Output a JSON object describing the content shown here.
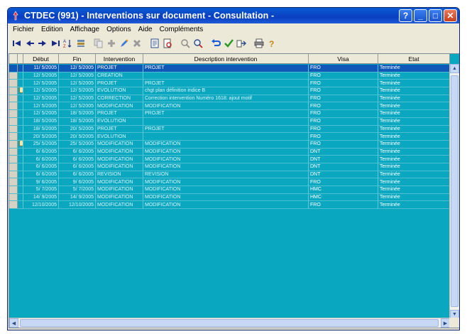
{
  "window": {
    "title": "CTDEC (991) - Interventions sur document - Consultation -",
    "buttons": {
      "help": "?",
      "minimize": "_",
      "maximize": "□",
      "close": "✕"
    }
  },
  "menu": [
    "Fichier",
    "Edition",
    "Affichage",
    "Options",
    "Aide",
    "Compléments"
  ],
  "toolbar": [
    "first-record-icon",
    "prev-record-icon",
    "next-record-icon",
    "last-record-icon",
    "sort-icon",
    "filter-icon",
    "copy-icon",
    "add-icon",
    "edit-icon",
    "delete-icon",
    "document-icon",
    "print-preview-icon",
    "search-icon",
    "find-next-icon",
    "undo-icon",
    "validate-icon",
    "export-icon",
    "print-icon",
    "help-icon"
  ],
  "grid": {
    "columns": [
      "Début",
      "Fin",
      "Intervention",
      "Description intervention",
      "Visa",
      "Etat"
    ],
    "rows": [
      {
        "debut": "11/ 5/2005",
        "fin": "12/ 5/2005",
        "intervention": "PROJET",
        "description": "PROJET",
        "visa": "FRO",
        "etat": "Terminée",
        "attach": false,
        "selected": true
      },
      {
        "debut": "12/ 5/2005",
        "fin": "12/ 5/2005",
        "intervention": "CREATION",
        "description": "",
        "visa": "FRO",
        "etat": "Terminée",
        "attach": false
      },
      {
        "debut": "12/ 5/2005",
        "fin": "12/ 5/2005",
        "intervention": "PROJET",
        "description": "PROJET",
        "visa": "FRO",
        "etat": "Terminée",
        "attach": false
      },
      {
        "debut": "12/ 5/2005",
        "fin": "12/ 5/2005",
        "intervention": "EVOLUTION",
        "description": "chgt plan définition indice B",
        "visa": "FRO",
        "etat": "Terminée",
        "attach": true
      },
      {
        "debut": "12/ 5/2005",
        "fin": "12/ 5/2005",
        "intervention": "CORRECTION",
        "description": "Correction intervention Numéro 1618: ajout motif",
        "visa": "FRO",
        "etat": "Terminée",
        "attach": false
      },
      {
        "debut": "12/ 5/2005",
        "fin": "12/ 5/2005",
        "intervention": "MODIFICATION",
        "description": "MODIFICATION",
        "visa": "FRO",
        "etat": "Terminée",
        "attach": false
      },
      {
        "debut": "12/ 5/2005",
        "fin": "18/ 5/2005",
        "intervention": "PROJET",
        "description": "PROJET",
        "visa": "FRO",
        "etat": "Terminée",
        "attach": false
      },
      {
        "debut": "18/ 5/2005",
        "fin": "18/ 5/2005",
        "intervention": "EVOLUTION",
        "description": "",
        "visa": "FRO",
        "etat": "Terminée",
        "attach": false
      },
      {
        "debut": "18/ 5/2005",
        "fin": "20/ 5/2005",
        "intervention": "PROJET",
        "description": "PROJET",
        "visa": "FRO",
        "etat": "Terminée",
        "attach": false
      },
      {
        "debut": "20/ 5/2005",
        "fin": "20/ 5/2005",
        "intervention": "EVOLUTION",
        "description": "",
        "visa": "FRO",
        "etat": "Terminée",
        "attach": false
      },
      {
        "debut": "25/ 5/2005",
        "fin": "25/ 5/2005",
        "intervention": "MODIFICATION",
        "description": "MODIFICATION",
        "visa": "FRO",
        "etat": "Terminée",
        "attach": true
      },
      {
        "debut": "6/ 6/2005",
        "fin": "6/ 6/2005",
        "intervention": "MODIFICATION",
        "description": "MODIFICATION",
        "visa": "DNT",
        "etat": "Terminée",
        "attach": false
      },
      {
        "debut": "6/ 6/2005",
        "fin": "6/ 6/2005",
        "intervention": "MODIFICATION",
        "description": "MODIFICATION",
        "visa": "DNT",
        "etat": "Terminée",
        "attach": false
      },
      {
        "debut": "6/ 6/2005",
        "fin": "6/ 6/2005",
        "intervention": "MODIFICATION",
        "description": "MODIFICATION",
        "visa": "DNT",
        "etat": "Terminée",
        "attach": false
      },
      {
        "debut": "6/ 6/2005",
        "fin": "6/ 6/2005",
        "intervention": "REVISION",
        "description": "REVISION",
        "visa": "DNT",
        "etat": "Terminée",
        "attach": false
      },
      {
        "debut": "9/ 6/2005",
        "fin": "9/ 6/2005",
        "intervention": "MODIFICATION",
        "description": "MODIFICATION",
        "visa": "FRO",
        "etat": "Terminée",
        "attach": false
      },
      {
        "debut": "5/ 7/2005",
        "fin": "5/ 7/2005",
        "intervention": "MODIFICATION",
        "description": "MODIFICATION",
        "visa": "HMC",
        "etat": "Terminée",
        "attach": false
      },
      {
        "debut": "14/ 9/2005",
        "fin": "14/ 9/2005",
        "intervention": "MODIFICATION",
        "description": "MODIFICATION",
        "visa": "HMC",
        "etat": "Terminée",
        "attach": false
      },
      {
        "debut": "12/10/2005",
        "fin": "12/10/2005",
        "intervention": "MODIFICATION",
        "description": "MODIFICATION",
        "visa": "FRO",
        "etat": "Terminée",
        "attach": false
      }
    ]
  },
  "scroll": {
    "up": "▲",
    "down": "▼",
    "left": "◀",
    "right": "▶"
  },
  "colors": {
    "grid_bg": "#0aa8c0",
    "selected_row": "#1058b8",
    "title_bar": "#0a4ccc"
  }
}
